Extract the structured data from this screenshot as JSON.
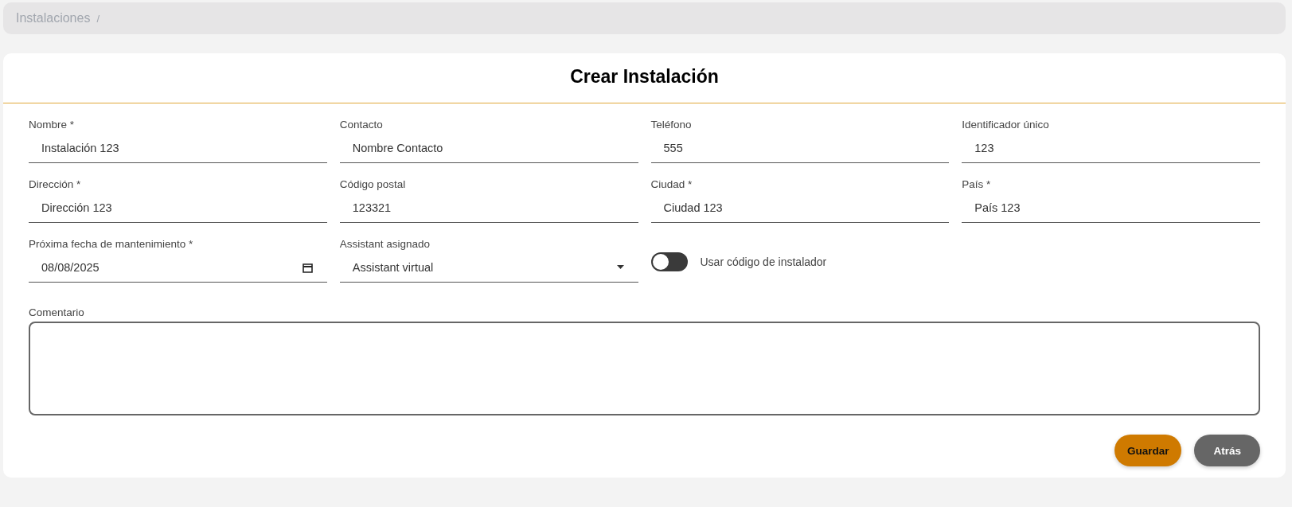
{
  "breadcrumb": {
    "items": [
      "Instalaciones"
    ],
    "separator": "/"
  },
  "form": {
    "title": "Crear Instalación",
    "fields": [
      {
        "kind": "text",
        "label": "Nombre *",
        "value": "Instalación 123"
      },
      {
        "kind": "text",
        "label": "Contacto",
        "value": "Nombre Contacto"
      },
      {
        "kind": "text",
        "label": "Teléfono",
        "value": "555"
      },
      {
        "kind": "text",
        "label": "Identificador único",
        "value": "123"
      },
      {
        "kind": "text",
        "label": "Dirección *",
        "value": "Dirección 123"
      },
      {
        "kind": "text",
        "label": "Código postal",
        "value": "123321"
      },
      {
        "kind": "text",
        "label": "Ciudad *",
        "value": "Ciudad 123"
      },
      {
        "kind": "text",
        "label": "País *",
        "value": "País 123"
      },
      {
        "kind": "date",
        "label": "Próxima fecha de mantenimiento *",
        "value": "08/08/2025"
      },
      {
        "kind": "select",
        "label": "Assistant asignado",
        "value": "Assistant virtual"
      },
      {
        "kind": "toggle",
        "label": "Usar código de instalador",
        "on": false
      }
    ],
    "comment": {
      "label": "Comentario"
    },
    "buttons": [
      {
        "kind": "primary",
        "label": "Guardar"
      },
      {
        "kind": "secondary",
        "label": "Atrás"
      }
    ]
  }
}
